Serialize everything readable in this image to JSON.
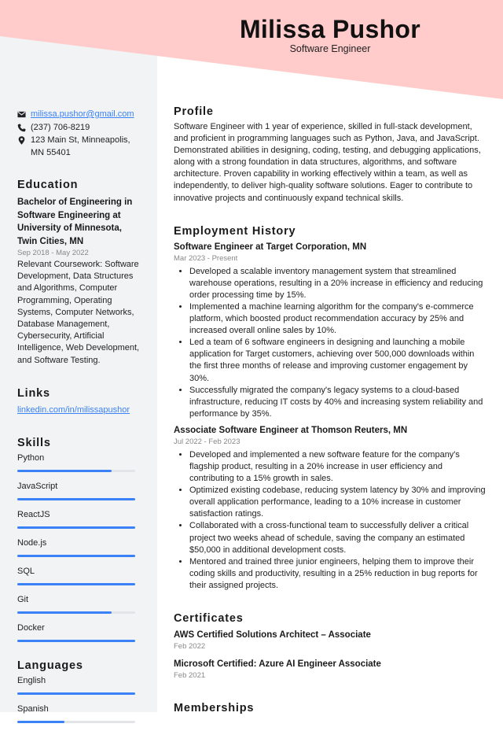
{
  "header": {
    "name": "Milissa Pushor",
    "title": "Software Engineer"
  },
  "colors": {
    "band": "#ffcccb",
    "sidebar": "#f2f3f5",
    "accent": "#3b82f6"
  },
  "contact": {
    "email": "milissa.pushor@gmail.com",
    "phone": "(237) 706-8219",
    "address": "123 Main St, Minneapolis, MN 55401",
    "email_icon": "envelope-icon",
    "phone_icon": "phone-icon",
    "address_icon": "map-pin-icon"
  },
  "education": {
    "heading": "Education",
    "degree": "Bachelor of Engineering in Software Engineering at University of Minnesota, Twin Cities, MN",
    "dates": "Sep 2018 - May 2022",
    "details": "Relevant Coursework: Software Development, Data Structures and Algorithms, Computer Programming, Operating Systems, Computer Networks, Database Management, Cybersecurity, Artificial Intelligence, Web Development, and Software Testing."
  },
  "links": {
    "heading": "Links",
    "items": [
      {
        "label": "linkedin.com/in/milissapushor"
      }
    ]
  },
  "skills": {
    "heading": "Skills",
    "items": [
      {
        "label": "Python",
        "level": 0.8
      },
      {
        "label": "JavaScript",
        "level": 1.0
      },
      {
        "label": "ReactJS",
        "level": 1.0
      },
      {
        "label": "Node.js",
        "level": 1.0
      },
      {
        "label": "SQL",
        "level": 1.0
      },
      {
        "label": "Git",
        "level": 0.8
      },
      {
        "label": "Docker",
        "level": 1.0
      }
    ]
  },
  "languages": {
    "heading": "Languages",
    "items": [
      {
        "label": "English",
        "level": 1.0
      },
      {
        "label": "Spanish",
        "level": 0.4
      }
    ]
  },
  "profile": {
    "heading": "Profile",
    "text": "Software Engineer with 1 year of experience, skilled in full-stack development, and proficient in programming languages such as Python, Java, and JavaScript. Demonstrated abilities in designing, coding, testing, and debugging applications, along with a strong foundation in data structures, algorithms, and software architecture. Proven capability in working effectively within a team, as well as independently, to deliver high-quality software solutions. Eager to contribute to innovative projects and continuously expand technical skills."
  },
  "employment": {
    "heading": "Employment History",
    "jobs": [
      {
        "title": "Software Engineer at Target Corporation, MN",
        "dates": "Mar 2023 - Present",
        "bullets": [
          "Developed a scalable inventory management system that streamlined warehouse operations, resulting in a 20% increase in efficiency and reducing order processing time by 15%.",
          "Implemented a machine learning algorithm for the company's e-commerce platform, which boosted product recommendation accuracy by 25% and increased overall online sales by 10%.",
          "Led a team of 6 software engineers in designing and launching a mobile application for Target customers, achieving over 500,000 downloads within the first three months of release and improving customer engagement by 30%.",
          "Successfully migrated the company's legacy systems to a cloud-based infrastructure, reducing IT costs by 40% and increasing system reliability and performance by 35%."
        ]
      },
      {
        "title": "Associate Software Engineer at Thomson Reuters, MN",
        "dates": "Jul 2022 - Feb 2023",
        "bullets": [
          "Developed and implemented a new software feature for the company's flagship product, resulting in a 20% increase in user efficiency and contributing to a 15% growth in sales.",
          "Optimized existing codebase, reducing system latency by 30% and improving overall application performance, leading to a 10% increase in customer satisfaction ratings.",
          "Collaborated with a cross-functional team to successfully deliver a critical project two weeks ahead of schedule, saving the company an estimated $50,000 in additional development costs.",
          "Mentored and trained three junior engineers, helping them to improve their coding skills and productivity, resulting in a 25% reduction in bug reports for their assigned projects."
        ]
      }
    ]
  },
  "certificates": {
    "heading": "Certificates",
    "items": [
      {
        "title": "AWS Certified Solutions Architect – Associate",
        "date": "Feb 2022"
      },
      {
        "title": "Microsoft Certified: Azure AI Engineer Associate",
        "date": "Feb 2021"
      }
    ]
  },
  "memberships": {
    "heading": "Memberships"
  }
}
